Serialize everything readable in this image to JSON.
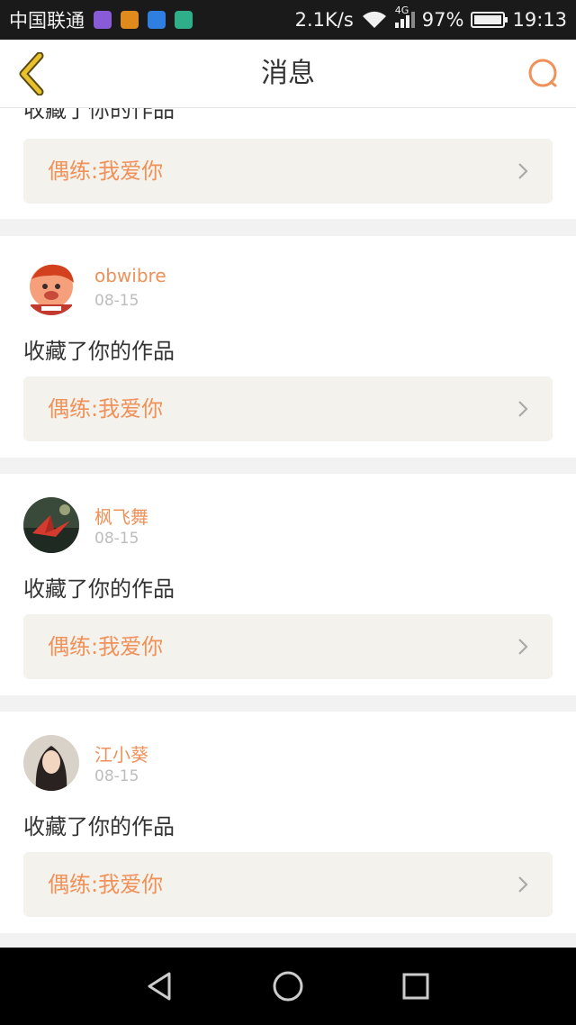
{
  "status_bar": {
    "carrier": "中国联通",
    "speed": "2.1K/s",
    "network": "4G",
    "battery_text": "97%",
    "battery_level": 0.97,
    "time": "19:13"
  },
  "header": {
    "title": "消息",
    "back_icon": "chevron-left-icon",
    "search_icon": "search-icon"
  },
  "colors": {
    "accent": "#f0915a",
    "back_arrow": "#e8c22e",
    "text": "#333333",
    "muted": "#bdbdbd",
    "card_bg": "#f4f2ec"
  },
  "messages": [
    {
      "action": "收藏了你的作品",
      "work_title": "偶练:我爱你"
    },
    {
      "username": "obwibre",
      "date": "08-15",
      "action": "收藏了你的作品",
      "work_title": "偶练:我爱你"
    },
    {
      "username": "枫飞舞",
      "date": "08-15",
      "action": "收藏了你的作品",
      "work_title": "偶练:我爱你"
    },
    {
      "username": "江小葵",
      "date": "08-15",
      "action": "收藏了你的作品",
      "work_title": "偶练:我爱你"
    }
  ],
  "nav": {
    "back_icon": "triangle-back-icon",
    "home_icon": "circle-home-icon",
    "recents_icon": "square-recents-icon"
  }
}
